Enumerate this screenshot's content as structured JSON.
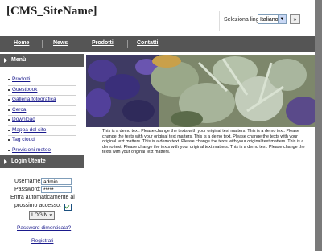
{
  "site": {
    "name": "[CMS_SiteName]"
  },
  "language": {
    "label": "Seleziona lingua:",
    "selected": "Italiano",
    "button": "»"
  },
  "nav": {
    "items": [
      "Home",
      "News",
      "Prodotti",
      "Contatti"
    ]
  },
  "sidebar": {
    "menu_title": "Menù",
    "menu_items": [
      "Prodotti",
      "Guestbook",
      "Galleria fotografica",
      "Cerca",
      "Download",
      "Mappa del sito",
      "Tag cloud",
      "Previsioni meteo"
    ],
    "login_title": "Login Utente",
    "username_label": "Username:",
    "username_value": "admin",
    "password_label": "Password:",
    "password_value": "*****",
    "remember_line1": "Entra automaticamente al",
    "remember_line2": "prossimo accesso:",
    "login_button": "LOGIN »",
    "forgot_link": "Password dimenticata?",
    "register_link": "Registrati"
  },
  "content": {
    "text": "This is a demo text. Please change the texts with your original text matters. This is a demo text. Please change the texts with your original text matters. This is a demo text. Please change the texts with your original text matters. This is a demo text. Please change the texts with your original text matters. This is a demo text. Please change the texts with your original text matters. This is a demo text. Please change the texts with your original text matters."
  },
  "colors": {
    "nav_bg": "#555555",
    "side_head_bg": "#595959",
    "link": "#1a1a8c"
  }
}
